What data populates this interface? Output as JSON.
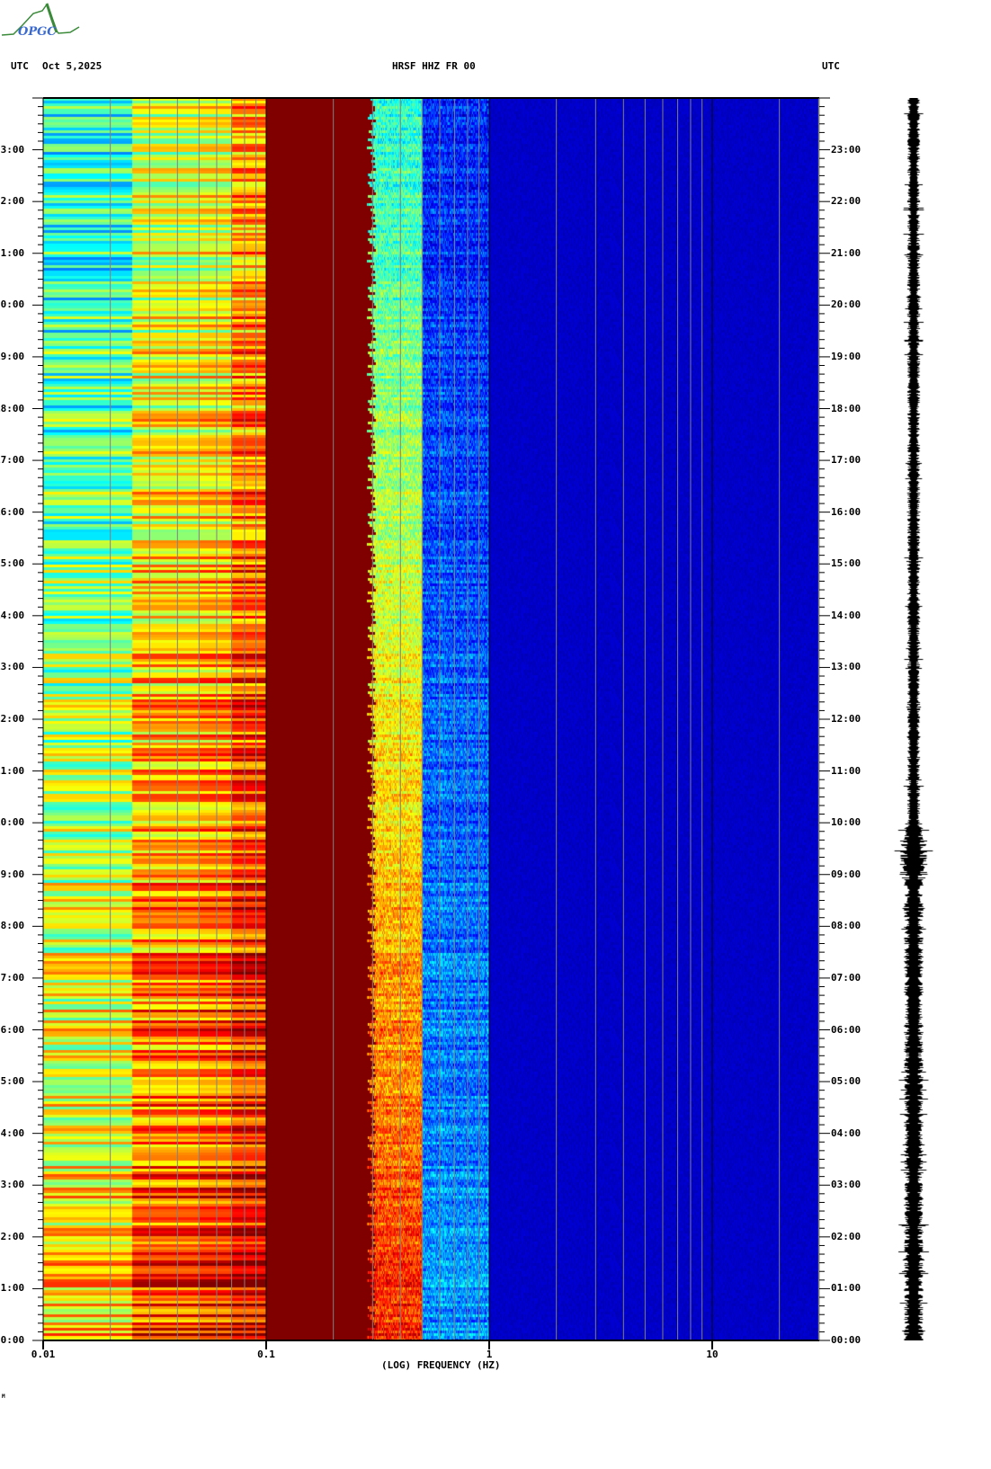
{
  "header": {
    "logo_text": "OPGC",
    "left_tz": "UTC",
    "date": "Oct 5,2025",
    "station": "HRSF HHZ FR 00",
    "right_tz": "UTC"
  },
  "footer_mark": "M",
  "colors": {
    "low": "#000080",
    "high": "#800000",
    "grid": "#808080",
    "decade_line": "#000000"
  },
  "chart_data": {
    "type": "heatmap",
    "title": "HRSF HHZ FR 00",
    "xlabel": "(LOG) FREQUENCY (HZ)",
    "ylabel": "UTC",
    "x_scale": "log",
    "xlim": [
      0.01,
      30
    ],
    "ylim_hours": [
      0,
      24
    ],
    "x_ticks": [
      {
        "value": 0.01,
        "label": "0.01"
      },
      {
        "value": 0.1,
        "label": "0.1"
      },
      {
        "value": 1,
        "label": "1"
      },
      {
        "value": 10,
        "label": "10"
      }
    ],
    "y_ticks": [
      {
        "hour": 0,
        "label": "00:00"
      },
      {
        "hour": 1,
        "label": "01:00"
      },
      {
        "hour": 2,
        "label": "02:00"
      },
      {
        "hour": 3,
        "label": "03:00"
      },
      {
        "hour": 4,
        "label": "04:00"
      },
      {
        "hour": 5,
        "label": "05:00"
      },
      {
        "hour": 6,
        "label": "06:00"
      },
      {
        "hour": 7,
        "label": "07:00"
      },
      {
        "hour": 8,
        "label": "08:00"
      },
      {
        "hour": 9,
        "label": "09:00"
      },
      {
        "hour": 10,
        "label": "10:00"
      },
      {
        "hour": 11,
        "label": "11:00"
      },
      {
        "hour": 12,
        "label": "12:00"
      },
      {
        "hour": 13,
        "label": "13:00"
      },
      {
        "hour": 14,
        "label": "14:00"
      },
      {
        "hour": 15,
        "label": "15:00"
      },
      {
        "hour": 16,
        "label": "16:00"
      },
      {
        "hour": 17,
        "label": "17:00"
      },
      {
        "hour": 18,
        "label": "18:00"
      },
      {
        "hour": 19,
        "label": "19:00"
      },
      {
        "hour": 20,
        "label": "20:00"
      },
      {
        "hour": 21,
        "label": "21:00"
      },
      {
        "hour": 22,
        "label": "22:00"
      },
      {
        "hour": 23,
        "label": "23:00"
      }
    ],
    "minor_tick_minutes": 10,
    "bands": [
      {
        "freq_range": [
          0.01,
          0.025
        ],
        "level_at_0h": 0.68,
        "level_at_24h": 0.38
      },
      {
        "freq_range": [
          0.025,
          0.05
        ],
        "level_at_0h": 0.82,
        "level_at_24h": 0.55
      },
      {
        "freq_range": [
          0.05,
          0.07
        ],
        "level_at_0h": 0.85,
        "level_at_24h": 0.58
      },
      {
        "freq_range": [
          0.07,
          0.1
        ],
        "level_at_0h": 0.9,
        "level_at_24h": 0.7
      },
      {
        "freq_range": [
          0.1,
          0.28
        ],
        "level_at_0h": 1.0,
        "level_at_24h": 1.0
      },
      {
        "freq_range": [
          0.28,
          0.5
        ],
        "level_at_0h": 0.85,
        "level_at_24h": 0.4
      },
      {
        "freq_range": [
          0.5,
          1.0
        ],
        "level_at_0h": 0.28,
        "level_at_24h": 0.15
      },
      {
        "freq_range": [
          1.0,
          30
        ],
        "level_at_0h": 0.05,
        "level_at_24h": 0.05
      }
    ],
    "colormap": "jet",
    "trace": "seismogram (right panel), higher amplitude 00:00-10:00"
  }
}
